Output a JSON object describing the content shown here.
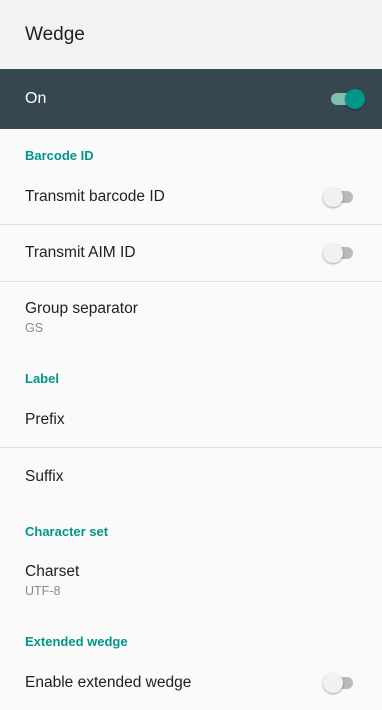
{
  "appbar": {
    "title": "Wedge"
  },
  "master": {
    "label": "On",
    "enabled": true
  },
  "sections": {
    "barcode_id": {
      "header": "Barcode ID",
      "transmit_barcode_id": {
        "title": "Transmit barcode ID",
        "enabled": false
      },
      "transmit_aim_id": {
        "title": "Transmit AIM ID",
        "enabled": false
      },
      "group_separator": {
        "title": "Group separator",
        "summary": "GS"
      }
    },
    "label": {
      "header": "Label",
      "prefix": {
        "title": "Prefix"
      },
      "suffix": {
        "title": "Suffix"
      }
    },
    "character_set": {
      "header": "Character set",
      "charset": {
        "title": "Charset",
        "summary": "UTF-8"
      }
    },
    "extended_wedge": {
      "header": "Extended wedge",
      "enable_extended_wedge": {
        "title": "Enable extended wedge",
        "enabled": false
      }
    }
  },
  "colors": {
    "accent": "#009688",
    "master_bar": "#37474f",
    "appbar": "#f2f2f2"
  },
  "icons": {
    "on_switch": "toggle-on-icon",
    "off_switch": "toggle-off-icon"
  }
}
